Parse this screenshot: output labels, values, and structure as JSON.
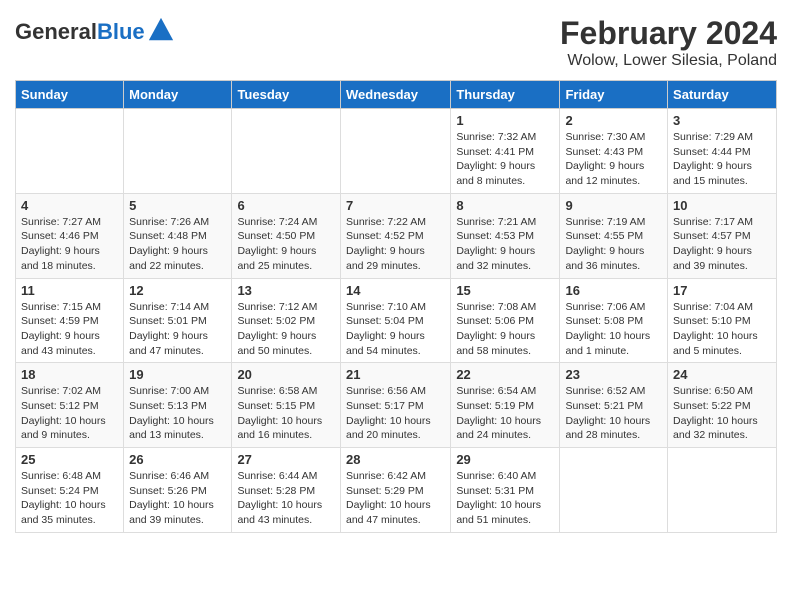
{
  "app": {
    "name": "GeneralBlue",
    "title": "February 2024",
    "subtitle": "Wolow, Lower Silesia, Poland"
  },
  "days_of_week": [
    "Sunday",
    "Monday",
    "Tuesday",
    "Wednesday",
    "Thursday",
    "Friday",
    "Saturday"
  ],
  "weeks": [
    [
      {
        "day": null,
        "info": null
      },
      {
        "day": null,
        "info": null
      },
      {
        "day": null,
        "info": null
      },
      {
        "day": null,
        "info": null
      },
      {
        "day": "1",
        "info": "Sunrise: 7:32 AM\nSunset: 4:41 PM\nDaylight: 9 hours\nand 8 minutes."
      },
      {
        "day": "2",
        "info": "Sunrise: 7:30 AM\nSunset: 4:43 PM\nDaylight: 9 hours\nand 12 minutes."
      },
      {
        "day": "3",
        "info": "Sunrise: 7:29 AM\nSunset: 4:44 PM\nDaylight: 9 hours\nand 15 minutes."
      }
    ],
    [
      {
        "day": "4",
        "info": "Sunrise: 7:27 AM\nSunset: 4:46 PM\nDaylight: 9 hours\nand 18 minutes."
      },
      {
        "day": "5",
        "info": "Sunrise: 7:26 AM\nSunset: 4:48 PM\nDaylight: 9 hours\nand 22 minutes."
      },
      {
        "day": "6",
        "info": "Sunrise: 7:24 AM\nSunset: 4:50 PM\nDaylight: 9 hours\nand 25 minutes."
      },
      {
        "day": "7",
        "info": "Sunrise: 7:22 AM\nSunset: 4:52 PM\nDaylight: 9 hours\nand 29 minutes."
      },
      {
        "day": "8",
        "info": "Sunrise: 7:21 AM\nSunset: 4:53 PM\nDaylight: 9 hours\nand 32 minutes."
      },
      {
        "day": "9",
        "info": "Sunrise: 7:19 AM\nSunset: 4:55 PM\nDaylight: 9 hours\nand 36 minutes."
      },
      {
        "day": "10",
        "info": "Sunrise: 7:17 AM\nSunset: 4:57 PM\nDaylight: 9 hours\nand 39 minutes."
      }
    ],
    [
      {
        "day": "11",
        "info": "Sunrise: 7:15 AM\nSunset: 4:59 PM\nDaylight: 9 hours\nand 43 minutes."
      },
      {
        "day": "12",
        "info": "Sunrise: 7:14 AM\nSunset: 5:01 PM\nDaylight: 9 hours\nand 47 minutes."
      },
      {
        "day": "13",
        "info": "Sunrise: 7:12 AM\nSunset: 5:02 PM\nDaylight: 9 hours\nand 50 minutes."
      },
      {
        "day": "14",
        "info": "Sunrise: 7:10 AM\nSunset: 5:04 PM\nDaylight: 9 hours\nand 54 minutes."
      },
      {
        "day": "15",
        "info": "Sunrise: 7:08 AM\nSunset: 5:06 PM\nDaylight: 9 hours\nand 58 minutes."
      },
      {
        "day": "16",
        "info": "Sunrise: 7:06 AM\nSunset: 5:08 PM\nDaylight: 10 hours\nand 1 minute."
      },
      {
        "day": "17",
        "info": "Sunrise: 7:04 AM\nSunset: 5:10 PM\nDaylight: 10 hours\nand 5 minutes."
      }
    ],
    [
      {
        "day": "18",
        "info": "Sunrise: 7:02 AM\nSunset: 5:12 PM\nDaylight: 10 hours\nand 9 minutes."
      },
      {
        "day": "19",
        "info": "Sunrise: 7:00 AM\nSunset: 5:13 PM\nDaylight: 10 hours\nand 13 minutes."
      },
      {
        "day": "20",
        "info": "Sunrise: 6:58 AM\nSunset: 5:15 PM\nDaylight: 10 hours\nand 16 minutes."
      },
      {
        "day": "21",
        "info": "Sunrise: 6:56 AM\nSunset: 5:17 PM\nDaylight: 10 hours\nand 20 minutes."
      },
      {
        "day": "22",
        "info": "Sunrise: 6:54 AM\nSunset: 5:19 PM\nDaylight: 10 hours\nand 24 minutes."
      },
      {
        "day": "23",
        "info": "Sunrise: 6:52 AM\nSunset: 5:21 PM\nDaylight: 10 hours\nand 28 minutes."
      },
      {
        "day": "24",
        "info": "Sunrise: 6:50 AM\nSunset: 5:22 PM\nDaylight: 10 hours\nand 32 minutes."
      }
    ],
    [
      {
        "day": "25",
        "info": "Sunrise: 6:48 AM\nSunset: 5:24 PM\nDaylight: 10 hours\nand 35 minutes."
      },
      {
        "day": "26",
        "info": "Sunrise: 6:46 AM\nSunset: 5:26 PM\nDaylight: 10 hours\nand 39 minutes."
      },
      {
        "day": "27",
        "info": "Sunrise: 6:44 AM\nSunset: 5:28 PM\nDaylight: 10 hours\nand 43 minutes."
      },
      {
        "day": "28",
        "info": "Sunrise: 6:42 AM\nSunset: 5:29 PM\nDaylight: 10 hours\nand 47 minutes."
      },
      {
        "day": "29",
        "info": "Sunrise: 6:40 AM\nSunset: 5:31 PM\nDaylight: 10 hours\nand 51 minutes."
      },
      {
        "day": null,
        "info": null
      },
      {
        "day": null,
        "info": null
      }
    ]
  ]
}
